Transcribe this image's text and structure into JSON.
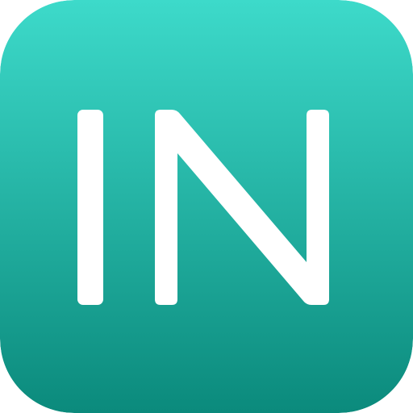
{
  "icon": {
    "monogram": "IN",
    "colors": {
      "gradient_top": "#3DDACA",
      "gradient_bottom": "#0B8A7C",
      "letter": "#FFFFFF"
    }
  }
}
